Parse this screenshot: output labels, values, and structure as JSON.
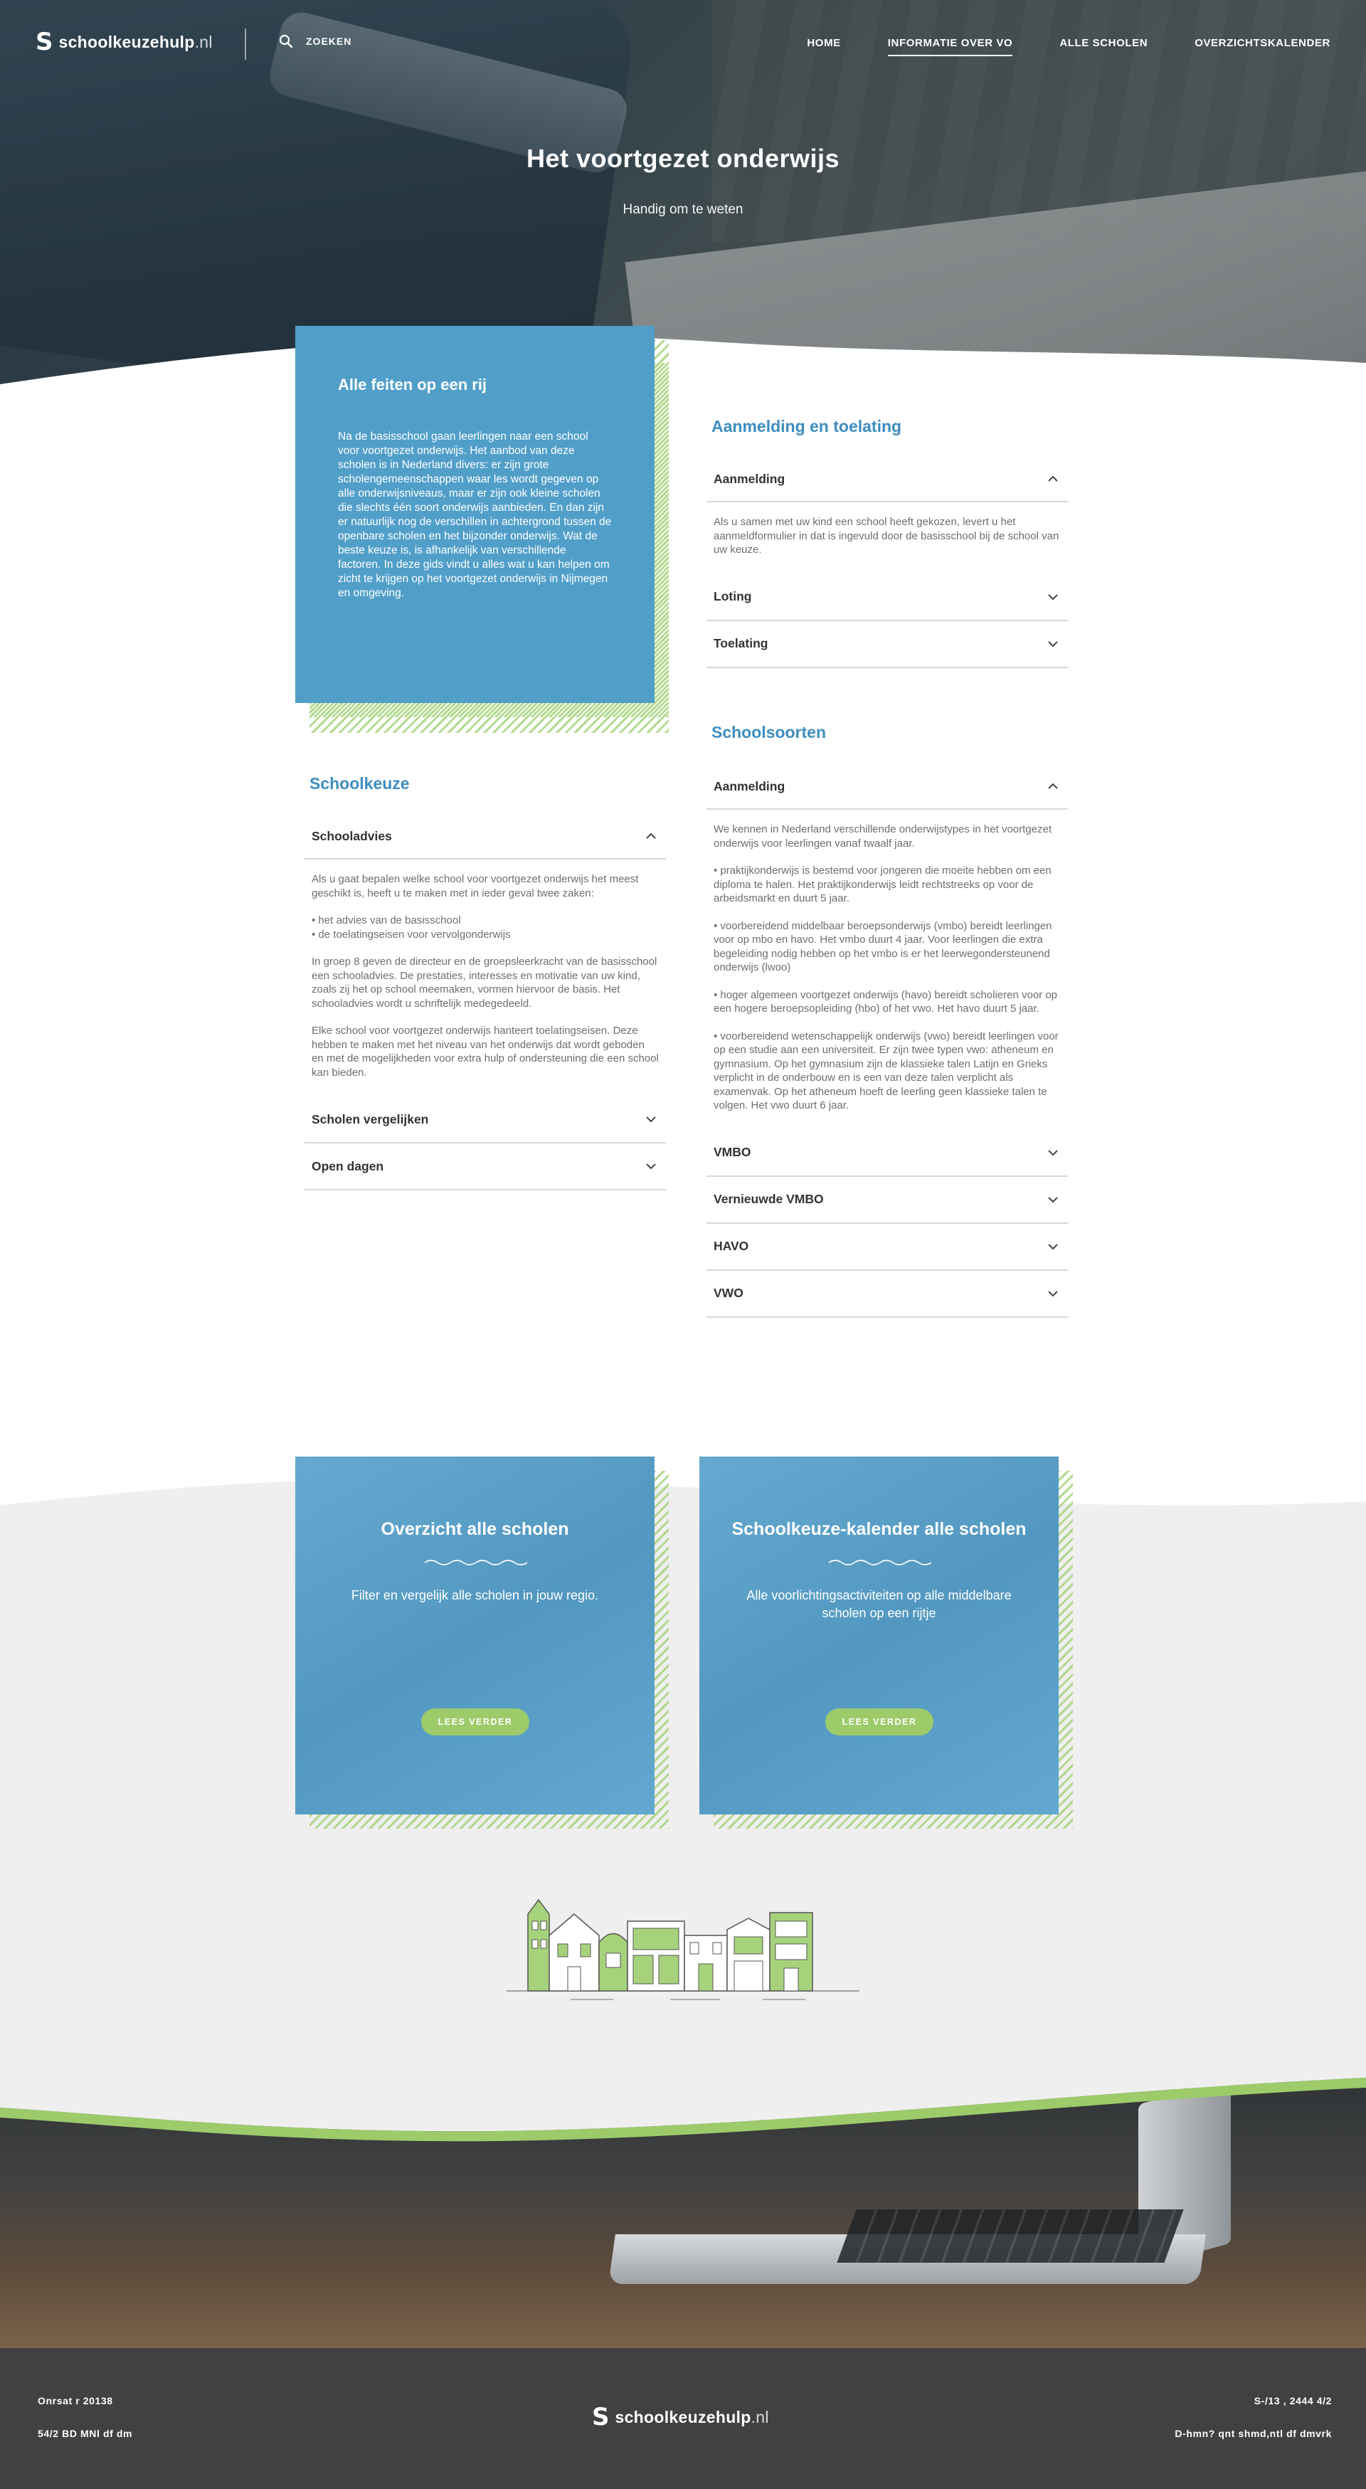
{
  "header": {
    "logo": {
      "mark": "S",
      "name": "schoolkeuzehulp",
      "tld": ".nl"
    },
    "search_label": "ZOEKEN",
    "menu": [
      {
        "label": "HOME",
        "active": false
      },
      {
        "label": "INFORMATIE OVER VO",
        "active": true
      },
      {
        "label": "ALLE SCHOLEN",
        "active": false
      },
      {
        "label": "OVERZICHTSKALENDER",
        "active": false
      }
    ]
  },
  "hero": {
    "title": "Het voortgezet onderwijs",
    "subtitle": "Handig om te weten"
  },
  "facts": {
    "title": "Alle feiten op een rij",
    "text": "Na de basisschool gaan leerlingen naar een school voor voortgezet onderwijs. Het aanbod van deze scholen is in Nederland divers: er zijn grote scholengemeenschappen waar les wordt gegeven op alle onderwijsniveaus, maar er zijn ook kleine scholen die slechts één soort onderwijs aanbieden. En dan zijn er natuurlijk nog de verschillen in achtergrond tussen de openbare scholen en het bijzonder onderwijs. Wat de beste keuze is, is afhankelijk van verschillende factoren. In deze gids vindt u alles wat u kan helpen om zicht te krijgen op het voortgezet onderwijs in Nijmegen en omgeving."
  },
  "schoolkeuze": {
    "title": "Schoolkeuze",
    "items": [
      {
        "label": "Schooladvies",
        "open": true,
        "paragraphs": [
          "Als u gaat bepalen welke school voor voortgezet onderwijs het meest geschikt is, heeft u te maken met in ieder geval twee zaken:",
          "• het advies van de basisschool\n• de toelatingseisen voor vervolgonderwijs",
          "In groep 8 geven de directeur en de groepsleerkracht van de basisschool een schooladvies. De prestaties, interesses en motivatie van uw kind, zoals zij het op school meemaken, vormen hiervoor de basis. Het schooladvies wordt u schriftelijk medegedeeld.",
          "Elke school voor voortgezet onderwijs hanteert toelatingseisen. Deze hebben te maken met het niveau van het onderwijs dat wordt geboden en met de mogelijkheden voor extra hulp of ondersteuning die een school kan bieden."
        ]
      },
      {
        "label": "Scholen vergelijken",
        "open": false
      },
      {
        "label": "Open dagen",
        "open": false
      }
    ]
  },
  "aanmelding": {
    "title": "Aanmelding en toelating",
    "items": [
      {
        "label": "Aanmelding",
        "open": true,
        "paragraphs": [
          "Als u samen met uw kind een school heeft gekozen, levert u het aanmeldformulier in dat is ingevuld door de basisschool bij de school van uw keuze."
        ]
      },
      {
        "label": "Loting",
        "open": false
      },
      {
        "label": "Toelating",
        "open": false
      }
    ]
  },
  "schoolsoorten": {
    "title": "Schoolsoorten",
    "items": [
      {
        "label": "Aanmelding",
        "open": true,
        "paragraphs": [
          "We kennen in Nederland verschillende onderwijstypes in het voortgezet onderwijs voor leerlingen vanaf twaalf jaar.",
          "• praktijkonderwijs is bestemd voor jongeren die moeite hebben om een diploma te halen. Het praktijkonderwijs leidt rechtstreeks op voor de arbeidsmarkt en duurt 5 jaar.",
          "• voorbereidend middelbaar beroepsonderwijs (vmbo) bereidt leerlingen voor op mbo en havo. Het vmbo duurt 4 jaar. Voor leerlingen die extra begeleiding nodig hebben op het vmbo is er het leerwegondersteunend onderwijs (lwoo)",
          "• hoger algemeen voortgezet onderwijs (havo) bereidt scholieren voor op een hogere beroepsopleiding (hbo) of het vwo. Het havo duurt 5 jaar.",
          "• voorbereidend wetenschappelijk onderwijs (vwo) bereidt leerlingen voor op een studie aan een universiteit. Er zijn twee typen vwo: atheneum en gymnasium. Op het gymnasium zijn de klassieke talen Latijn en Grieks verplicht in de onderbouw en is een van deze talen verplicht als examenvak. Op het atheneum hoeft de leerling geen klassieke talen te volgen. Het vwo duurt 6 jaar."
        ]
      },
      {
        "label": "VMBO",
        "open": false
      },
      {
        "label": "Vernieuwde VMBO",
        "open": false
      },
      {
        "label": "HAVO",
        "open": false
      },
      {
        "label": "VWO",
        "open": false
      }
    ]
  },
  "cards": [
    {
      "title": "Overzicht alle scholen",
      "text": "Filter en vergelijk alle scholen in jouw regio.",
      "button": "LEES VERDER"
    },
    {
      "title": "Schoolkeuze-kalender alle scholen",
      "text": "Alle voorlichtingsactiviteiten op alle middelbare scholen op een rijtje",
      "button": "LEES VERDER"
    }
  ],
  "footer": {
    "top_left": "Onrsat r 20138",
    "bottom_left": "54/2 BD MNl df dm",
    "top_right": "S-/13 , 2444 4/2",
    "bottom_right": "D-hmn? qnt shmd,ntl df dmvrk"
  },
  "colors": {
    "primary_blue": "#519fc9",
    "title_blue": "#3d8dbf",
    "accent_green": "#9dcb6a",
    "footer_bg": "#434041"
  },
  "icons": {
    "search": "search-icon",
    "chevron_up": "chevron-up-icon",
    "chevron_down": "chevron-down-icon"
  }
}
